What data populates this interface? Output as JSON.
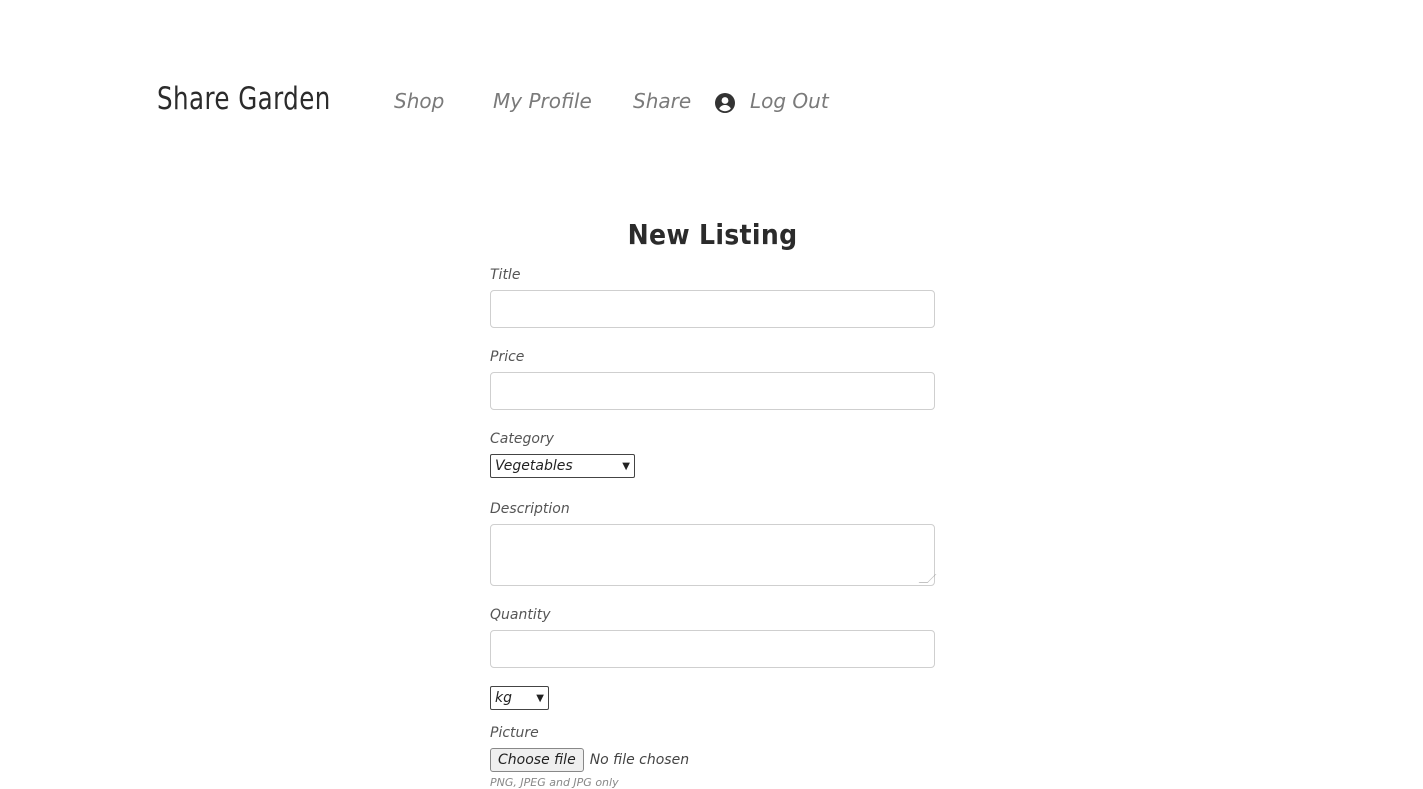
{
  "nav": {
    "brand": "Share Garden",
    "links": [
      {
        "label": "Shop"
      },
      {
        "label": "My Profile"
      },
      {
        "label": "Share"
      },
      {
        "label": "Log Out"
      }
    ],
    "user_icon": "user-circle-icon"
  },
  "form": {
    "title": "New Listing",
    "title_label": "Title",
    "title_value": "",
    "price_label": "Price",
    "price_value": "",
    "category_label": "Category",
    "category_selected": "Vegetables",
    "description_label": "Description",
    "description_value": "",
    "quantity_label": "Quantity",
    "quantity_value": "",
    "unit_selected": "kg",
    "picture_label": "Picture",
    "file_button": "Choose file",
    "file_status": "No file chosen",
    "file_hint": "PNG, JPEG and JPG only"
  }
}
